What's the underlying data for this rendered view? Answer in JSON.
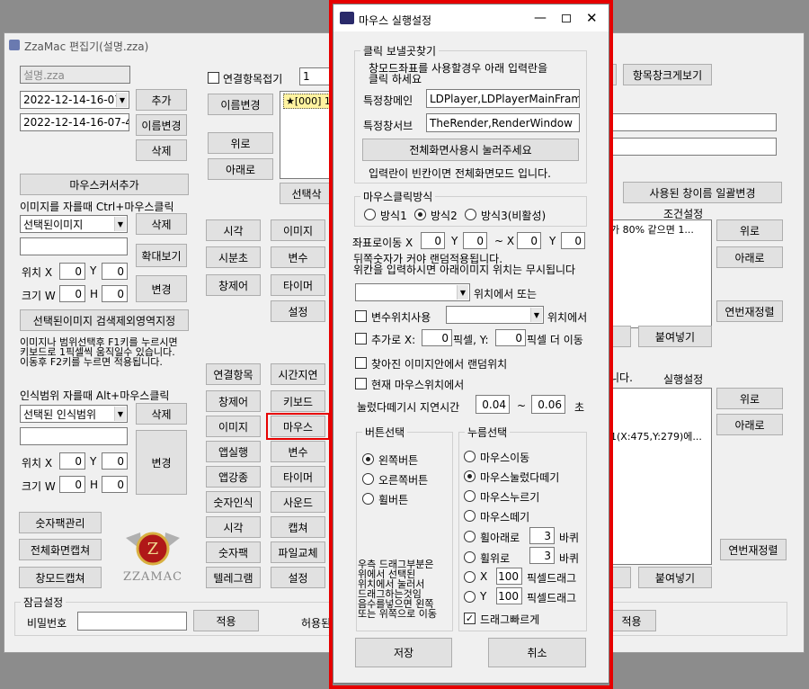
{
  "main": {
    "title": "ZzaMac 편집기(설명.zza)",
    "file_name": "설명.zza",
    "date1": "2022-12-14-16-07-",
    "date2": "2022-12-14-16-07-41",
    "add_btn": "추가",
    "rename_btn": "이름변경",
    "delete_btn": "삭제",
    "mouse_cursor_add": "마우스커서추가",
    "crop_hint": "이미지를 자를때 Ctrl+마우스클릭",
    "selected_image": "선택된이미지",
    "delete_btn2": "삭제",
    "zoom_btn": "확대보기",
    "pos_label": "위치 X",
    "pos_x": "0",
    "y_label": "Y",
    "pos_y": "0",
    "size_label": "크기 W",
    "size_w": "0",
    "h_label": "H",
    "size_h": "0",
    "change_btn": "변경",
    "search_exclude_btn": "선택된이미지 검색제외영역지정",
    "range_hint": "이미지나 범위선택후 F1키를 누르시면\n키보드로 1픽셀씩 움직일수 있습니다.\n이동후 F2키를 누르면 적용됩니다.",
    "recog_hint": "인식범위 자를때 Alt+마우스클릭",
    "selected_range": "선택된 인식범위",
    "delete_btn3": "삭제",
    "change_btn2": "변경",
    "pos_x2": "0",
    "pos_y2": "0",
    "size_w2": "0",
    "size_h2": "0",
    "numpad_btn": "숫자팩관리",
    "fullscreen_cap_btn": "전체화면캡쳐",
    "window_cap_btn": "창모드캡쳐",
    "logo_text": "ZZAMAC",
    "link_item_label": "연결항목접기",
    "link_count": "1",
    "rename_btn2": "이름변경",
    "up_btn": "위로",
    "down_btn": "아래로",
    "list_item": "★[000] 1",
    "select_del_btn": "선택삭",
    "cmd_left": [
      "시각",
      "시분초",
      "창제어"
    ],
    "cmd_right": [
      "이미지",
      "변수",
      "타이머",
      "설정"
    ],
    "cmd2_left": [
      "연결항목",
      "창제어",
      "이미지",
      "앱실행",
      "앱강종",
      "숫자인식",
      "시각",
      "숫자팩",
      "텔레그램"
    ],
    "cmd2_right": [
      "시간지연",
      "키보드",
      "마우스",
      "변수",
      "타이머",
      "사운드",
      "캡쳐",
      "파일교체",
      "설정"
    ],
    "lock_group": "잠금설정",
    "password_label": "비밀번호",
    "apply_btn": "적용",
    "allow_label": "허용된",
    "apply_btn2": "적용",
    "item_window_btn": "항목창크게보기",
    "used_window_btn": "사용된 창이름 일괄변경",
    "cond_label": "조건설정",
    "cond_item": "가 80% 같으면 1...",
    "up_btn2": "위로",
    "down_btn2": "아래로",
    "renumber_btn": "연번재정렬",
    "paste_btn": "붙여넣기",
    "exec_label": "실행설정",
    "partial_label": "니다.",
    "exec_item": "1(X:475,Y:279)에...",
    "up_btn3": "위로",
    "down_btn3": "아래로",
    "renumber_btn2": "연번재정렬",
    "paste_btn2": "붙여넣기"
  },
  "dialog": {
    "title": "마우스 실행설정",
    "click_group": "클릭 보낼곳찾기",
    "click_hint": "창모드좌표를 사용할경우 아래 입력란을\n클릭 하세요",
    "main_window_label": "특정창메인",
    "main_window_value": "LDPlayer,LDPlayerMainFrame",
    "sub_window_label": "특정창서브",
    "sub_window_value": "TheRender,RenderWindow",
    "fullscreen_btn": "전체화면사용시 눌러주세요",
    "fullscreen_hint": "입력란이 빈칸이면 전체화면모드 입니다.",
    "click_method_group": "마우스클릭방식",
    "method1": "방식1",
    "method2": "방식2",
    "method3": "방식3(비활성)",
    "coord_label": "좌표로이동 X",
    "x1": "0",
    "y_label": "Y",
    "y1": "0",
    "tilde_x": "~ X",
    "x2": "0",
    "y2": "0",
    "random_hint": "뒤쪽숫자가 커야 랜덤적용됩니다.\n위칸을 입력하시면 아래이미지 위치는 무시됩니다",
    "position_suffix": "위치에서 또는",
    "var_pos_label": "변수위치사용",
    "var_pos_suffix": "위치에서",
    "extra_label": "추가로 X:",
    "extra_x": "0",
    "px_y_label": "픽셀, Y:",
    "extra_y": "0",
    "extra_suffix": "픽셀 더 이동",
    "random_pos_label": "찾아진 이미지안에서 랜덤위치",
    "current_pos_label": "현재 마우스위치에서",
    "delay_label": "눌렀다떼기시 지연시간",
    "delay_min": "0.04",
    "tilde": "~",
    "delay_max": "0.06",
    "sec": "초",
    "button_group": "버튼선택",
    "left_btn": "왼쪽버튼",
    "right_btn": "오른쪽버튼",
    "wheel_btn": "휠버튼",
    "drag_hint": "우측 드래그부분은\n위에서 선택된\n위치에서 눌러서\n드래그하는것임\n음수를넣으면 왼쪽\n또는 위쪽으로 이동",
    "press_group": "누름선택",
    "mouse_move": "마우스이동",
    "mouse_click": "마우스눌렀다떼기",
    "mouse_down": "마우스누르기",
    "mouse_up": "마우스떼기",
    "wheel_down": "휠아래로",
    "wheel_down_val": "3",
    "wheel_up": "휠위로",
    "wheel_up_val": "3",
    "rotation": "바퀴",
    "drag_x_label": "X",
    "drag_x_val": "100",
    "drag_y_label": "Y",
    "drag_y_val": "100",
    "px_drag": "픽셀드래그",
    "fast_drag": "드래그빠르게",
    "save_btn": "저장",
    "cancel_btn": "취소"
  },
  "colors": {
    "highlight": "#e60000",
    "list_select": "#fff3a0"
  }
}
